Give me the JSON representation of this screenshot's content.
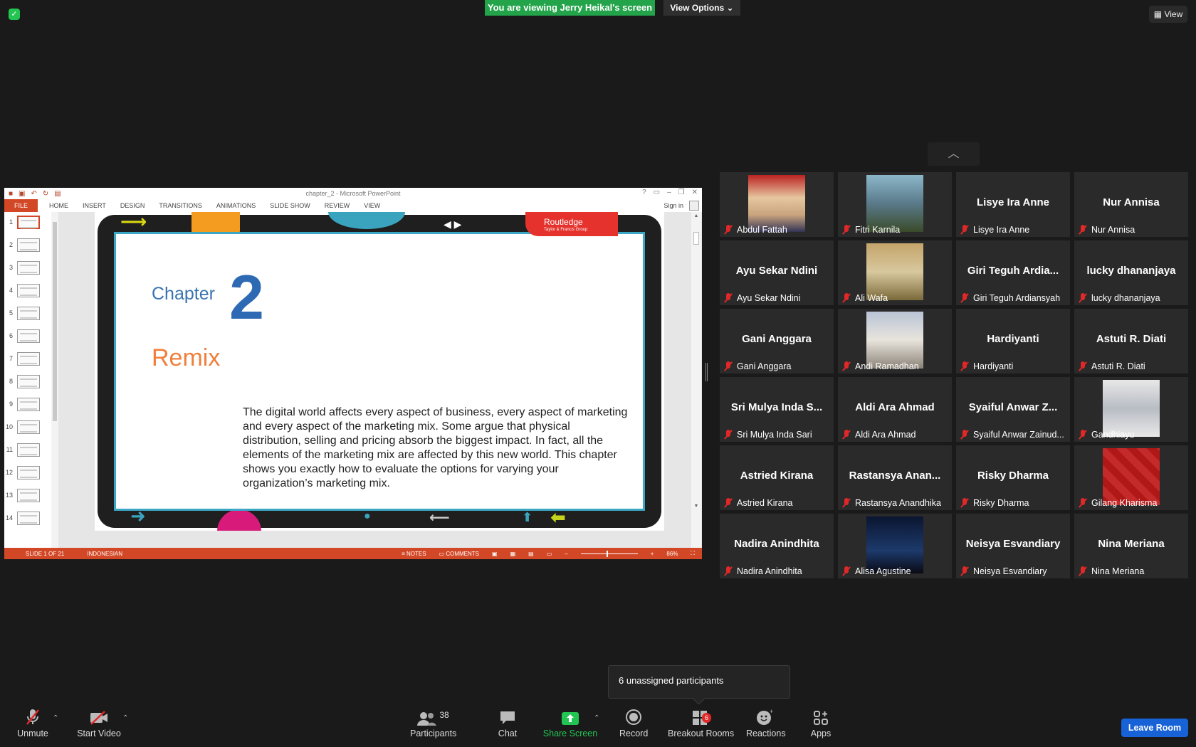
{
  "top": {
    "viewing_banner": "You are viewing Jerry Heikal's screen",
    "view_options": "View Options",
    "view_button": "View"
  },
  "ppt": {
    "window_title": "chapter_2 - Microsoft PowerPoint",
    "sign_in": "Sign in",
    "tabs": [
      "FILE",
      "HOME",
      "INSERT",
      "DESIGN",
      "TRANSITIONS",
      "ANIMATIONS",
      "SLIDE SHOW",
      "REVIEW",
      "VIEW"
    ],
    "thumb_numbers": [
      "1",
      "2",
      "3",
      "4",
      "5",
      "6",
      "7",
      "8",
      "9",
      "10",
      "11",
      "12",
      "13",
      "14"
    ],
    "slide": {
      "chapter_label": "Chapter",
      "chapter_number": "2",
      "title": "Remix",
      "body": "The digital world affects every aspect of business, every aspect of marketing and every aspect of the marketing mix. Some argue that physical distribution, selling and pricing absorb the biggest impact. In fact, all the elements of the marketing mix are affected by this new world. This chapter shows you exactly how to evaluate the options for varying your organization’s marketing mix.",
      "publisher": "Routledge",
      "publisher_sub": "Taylor & Francis Group"
    },
    "status": {
      "slide_info": "SLIDE 1 OF 21",
      "language": "INDONESIAN",
      "notes": "NOTES",
      "comments": "COMMENTS",
      "zoom": "86%"
    }
  },
  "participants": [
    {
      "center": "",
      "label": "Abdul Fattah",
      "photo": true
    },
    {
      "center": "",
      "label": "Fitri Karnila",
      "photo": true
    },
    {
      "center": "Lisye Ira Anne",
      "label": "Lisye Ira Anne",
      "photo": false
    },
    {
      "center": "Nur Annisa",
      "label": "Nur Annisa",
      "photo": false
    },
    {
      "center": "Ayu Sekar Ndini",
      "label": "Ayu Sekar Ndini",
      "photo": false
    },
    {
      "center": "",
      "label": "Ali Wafa",
      "photo": true
    },
    {
      "center": "Giri Teguh Ardia...",
      "label": "Giri Teguh Ardiansyah",
      "photo": false
    },
    {
      "center": "lucky dhananjaya",
      "label": "lucky dhananjaya",
      "photo": false
    },
    {
      "center": "Gani Anggara",
      "label": "Gani Anggara",
      "photo": false
    },
    {
      "center": "",
      "label": "Andi Ramadhan",
      "photo": true
    },
    {
      "center": "Hardiyanti",
      "label": "Hardiyanti",
      "photo": false
    },
    {
      "center": "Astuti R. Diati",
      "label": "Astuti R. Diati",
      "photo": false
    },
    {
      "center": "Sri Mulya Inda S...",
      "label": "Sri Mulya Inda Sari",
      "photo": false
    },
    {
      "center": "Aldi Ara Ahmad",
      "label": "Aldi Ara Ahmad",
      "photo": false
    },
    {
      "center": "Syaiful Anwar Z...",
      "label": "Syaiful Anwar Zainud...",
      "photo": false
    },
    {
      "center": "",
      "label": "Gandhiayu",
      "photo": true
    },
    {
      "center": "Astried Kirana",
      "label": "Astried Kirana",
      "photo": false
    },
    {
      "center": "Rastansya Anan...",
      "label": "Rastansya Anandhika",
      "photo": false
    },
    {
      "center": "Risky Dharma",
      "label": "Risky Dharma",
      "photo": false
    },
    {
      "center": "",
      "label": "Gilang Kharisma",
      "photo": true
    },
    {
      "center": "Nadira Anindhita",
      "label": "Nadira Anindhita",
      "photo": false
    },
    {
      "center": "",
      "label": "Alisa Agustine",
      "photo": true
    },
    {
      "center": "Neisya Esvandiary",
      "label": "Neisya Esvandiary",
      "photo": false
    },
    {
      "center": "Nina Meriana",
      "label": "Nina Meriana",
      "photo": false
    }
  ],
  "toast": "6 unassigned participants",
  "toolbar": {
    "unmute": "Unmute",
    "start_video": "Start Video",
    "participants": "Participants",
    "participants_count": "38",
    "chat": "Chat",
    "share_screen": "Share Screen",
    "record": "Record",
    "breakout_rooms": "Breakout Rooms",
    "breakout_badge": "6",
    "reactions": "Reactions",
    "apps": "Apps",
    "leave_room": "Leave Room"
  },
  "colors": {
    "share_green": "#23c552",
    "banner_green": "#23a44a",
    "leave_blue": "#1762d6",
    "ppt_orange": "#d24726",
    "muted_red": "#e02828"
  }
}
